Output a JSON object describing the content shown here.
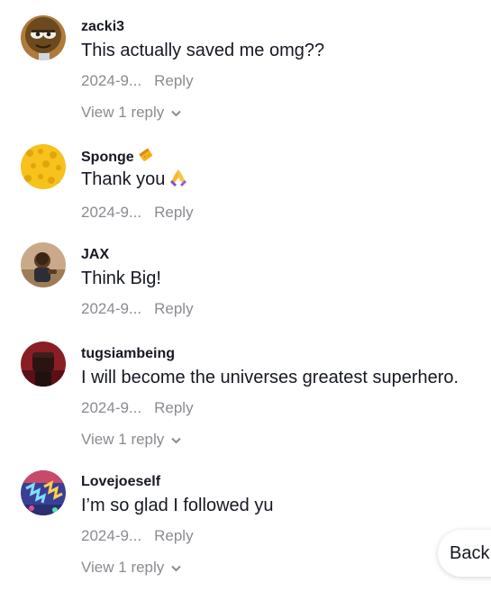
{
  "comments": [
    {
      "username": "zacki3",
      "text": "This actually saved me omg??",
      "date": "2024-9...",
      "reply_label": "Reply",
      "view_replies": "View 1 reply",
      "avatar": "cartoon-face-avatar"
    },
    {
      "username": "Sponge",
      "badge": "sponge-emoji",
      "text": "Thank you",
      "text_emoji": "folded-hands-emoji",
      "date": "2024-9...",
      "reply_label": "Reply",
      "avatar": "yellow-sponge-avatar"
    },
    {
      "username": "JAX",
      "text": "Think Big!",
      "date": "2024-9...",
      "reply_label": "Reply",
      "avatar": "child-photo-avatar"
    },
    {
      "username": "tugsiambeing",
      "text": "I will become the universes greatest superhero.",
      "date": "2024-9...",
      "reply_label": "Reply",
      "view_replies": "View 1 reply",
      "avatar": "fist-avatar"
    },
    {
      "username": "Lovejoeself",
      "text": "I’m so glad I followed yu",
      "date": "2024-9...",
      "reply_label": "Reply",
      "view_replies": "View 1 reply",
      "avatar": "graffiti-avatar"
    }
  ],
  "back_button": {
    "label": "Back"
  },
  "colors": {
    "text_primary": "#161823",
    "text_secondary": "#8a8b91"
  }
}
